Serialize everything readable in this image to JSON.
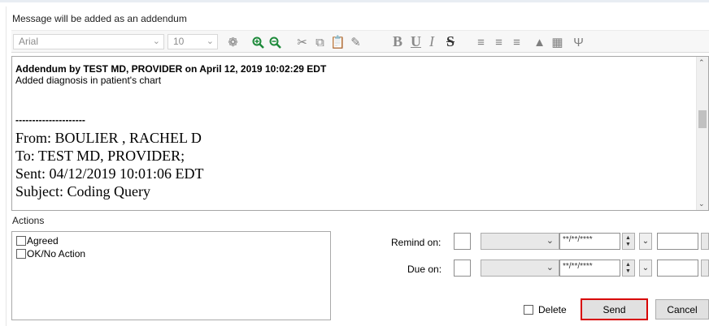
{
  "header": {
    "hint": "Message will be added as an addendum"
  },
  "toolbar": {
    "font_family": "Arial",
    "font_size": "10",
    "format_bold": "B",
    "format_underline": "U",
    "format_italic": "I",
    "format_strike": "S"
  },
  "editor": {
    "line1": "Addendum by TEST MD, PROVIDER on April 12, 2019 10:02:29 EDT",
    "line2": "Added diagnosis in patient's chart",
    "separator": "---------------------",
    "from": "From: BOULIER , RACHEL D",
    "to": "To: TEST MD, PROVIDER;",
    "sent": "Sent: 04/12/2019 10:01:06 EDT",
    "subject": "Subject: Coding Query"
  },
  "actions": {
    "label": "Actions",
    "items": [
      {
        "label": "Agreed",
        "checked": false
      },
      {
        "label": "OK/No Action",
        "checked": false
      }
    ]
  },
  "remind": {
    "label": "Remind on:",
    "date_placeholder": "**/**/****"
  },
  "due": {
    "label": "Due on:",
    "date_placeholder": "**/**/****"
  },
  "footer": {
    "delete_label": "Delete",
    "send_label": "Send",
    "cancel_label": "Cancel"
  },
  "colors": {
    "send_highlight": "#d80000",
    "zoom_icon": "#1d8a3a"
  }
}
